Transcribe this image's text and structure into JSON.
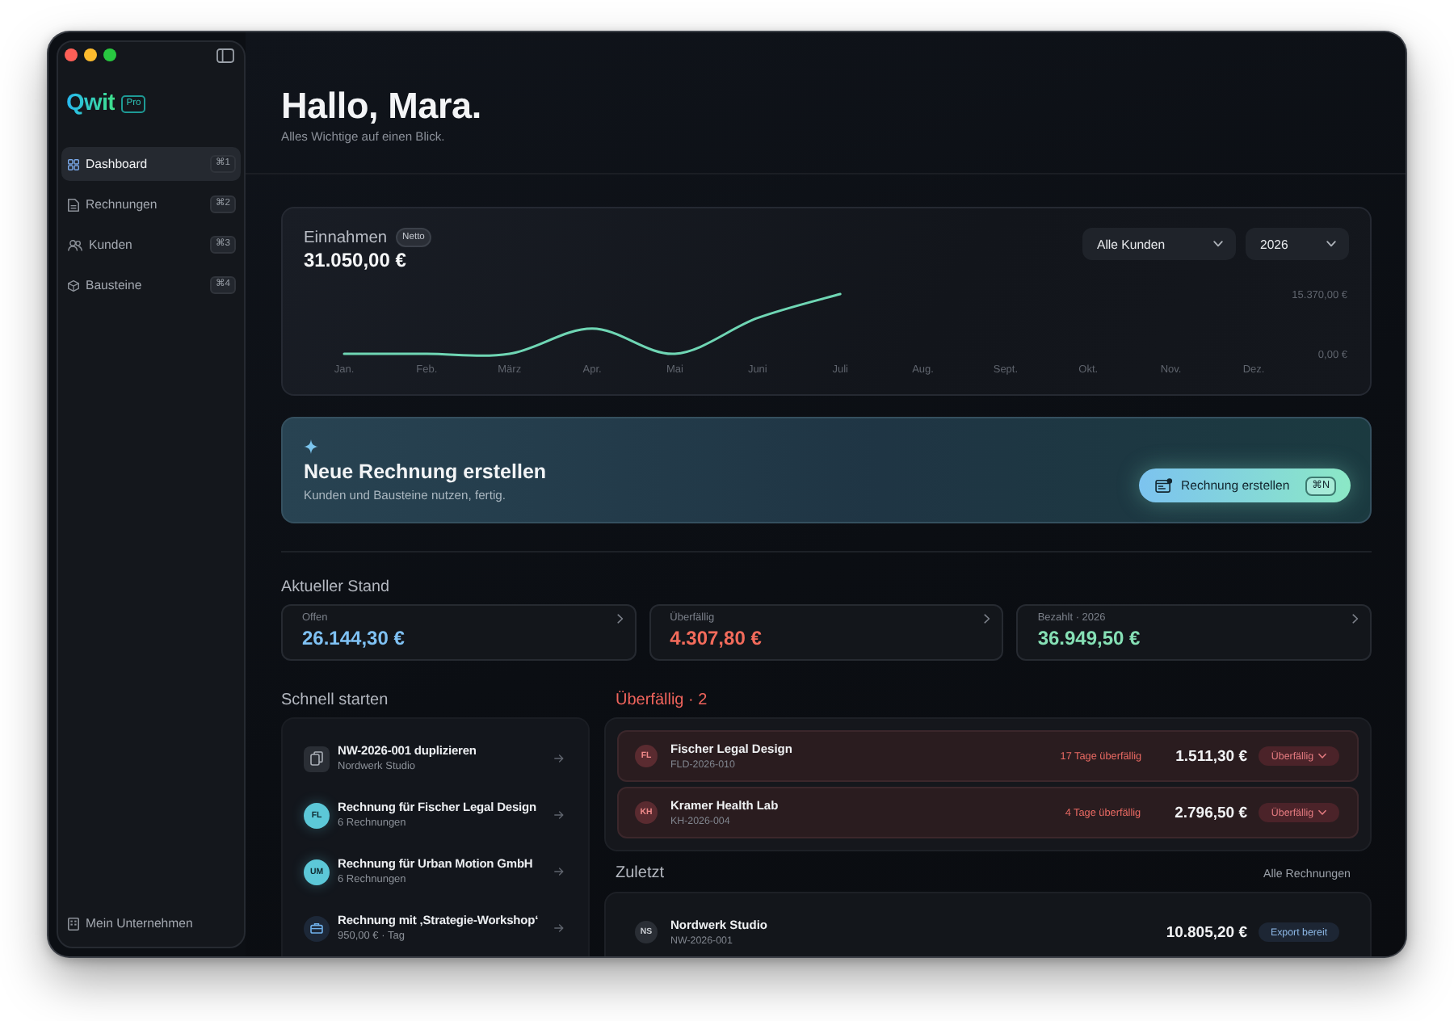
{
  "sidebar": {
    "logo": "Qwit",
    "plan": "Pro",
    "items": [
      {
        "label": "Dashboard",
        "shortcut": "⌘1",
        "selected": true
      },
      {
        "label": "Rechnungen",
        "shortcut": "⌘2",
        "selected": false
      },
      {
        "label": "Kunden",
        "shortcut": "⌘3",
        "selected": false
      },
      {
        "label": "Bausteine",
        "shortcut": "⌘4",
        "selected": false
      }
    ],
    "footer_item": "Mein Unternehmen"
  },
  "header": {
    "greeting": "Hallo, Mara.",
    "subtitle": "Alles Wichtige auf einen Blick."
  },
  "revenue": {
    "badge": "Netto",
    "total": "31.050,00 €",
    "filters": [
      "Alle Kunden",
      "2026"
    ],
    "chart_data": {
      "type": "line",
      "title": "Einnahmen",
      "categories": [
        "Jan.",
        "Feb.",
        "März",
        "Apr.",
        "Mai",
        "Juni",
        "Juli",
        "Aug.",
        "Sept.",
        "Okt.",
        "Nov.",
        "Dez."
      ],
      "series": [
        {
          "color": "#6fd6b4",
          "values": [
            0,
            0,
            0,
            6500,
            0,
            9200,
            15370,
            null,
            null,
            null,
            null,
            null
          ]
        }
      ],
      "ylim": [
        0,
        15370
      ],
      "yticks": [
        {
          "value": 0,
          "label": "0,00 €"
        },
        {
          "value": 15370,
          "label": "15.370,00 €"
        }
      ]
    }
  },
  "cta": {
    "title": "Neue Rechnung erstellen",
    "subtitle": "Kunden und Bausteine nutzen, fertig.",
    "button": {
      "label": "Rechnung erstellen",
      "shortcut": "⌘N"
    }
  },
  "status": {
    "title": "Aktueller Stand",
    "cards": [
      {
        "label": "Offen",
        "value": "26.144,30 €",
        "color": "#7fc1f3"
      },
      {
        "label": "Überfällig",
        "value": "4.307,80 €",
        "color": "#f26b5b"
      },
      {
        "label": "Bezahlt · 2026",
        "value": "36.949,50 €",
        "color": "#86e0b5"
      }
    ]
  },
  "quick_start": {
    "title": "Schnell starten",
    "items": [
      {
        "kind": "duplicate",
        "title": "NW-2026-001 duplizieren",
        "subtitle": "Nordwerk Studio"
      },
      {
        "kind": "customer",
        "initials": "FL",
        "title": "Rechnung für Fischer Legal Design",
        "subtitle": "6 Rechnungen"
      },
      {
        "kind": "customer",
        "initials": "UM",
        "title": "Rechnung für Urban Motion GmbH",
        "subtitle": "6 Rechnungen"
      },
      {
        "kind": "block",
        "title": "Rechnung mit ‚Strategie-Workshop‘",
        "subtitle": "950,00 € · Tag"
      }
    ]
  },
  "overdue": {
    "title": "Überfällig · 2",
    "rows": [
      {
        "initials": "FL",
        "name": "Fischer Legal Design",
        "number": "FLD-2026-010",
        "days": "17 Tage überfällig",
        "amount": "1.511,30 €",
        "status": "Überfällig"
      },
      {
        "initials": "KH",
        "name": "Kramer Health Lab",
        "number": "KH-2026-004",
        "days": "4 Tage überfällig",
        "amount": "2.796,50 €",
        "status": "Überfällig"
      }
    ]
  },
  "recent": {
    "title": "Zuletzt",
    "link": "Alle Rechnungen",
    "rows": [
      {
        "initials": "NS",
        "name": "Nordwerk Studio",
        "number": "NW-2026-001",
        "amount": "10.805,20 €",
        "status": "Export bereit"
      }
    ]
  }
}
